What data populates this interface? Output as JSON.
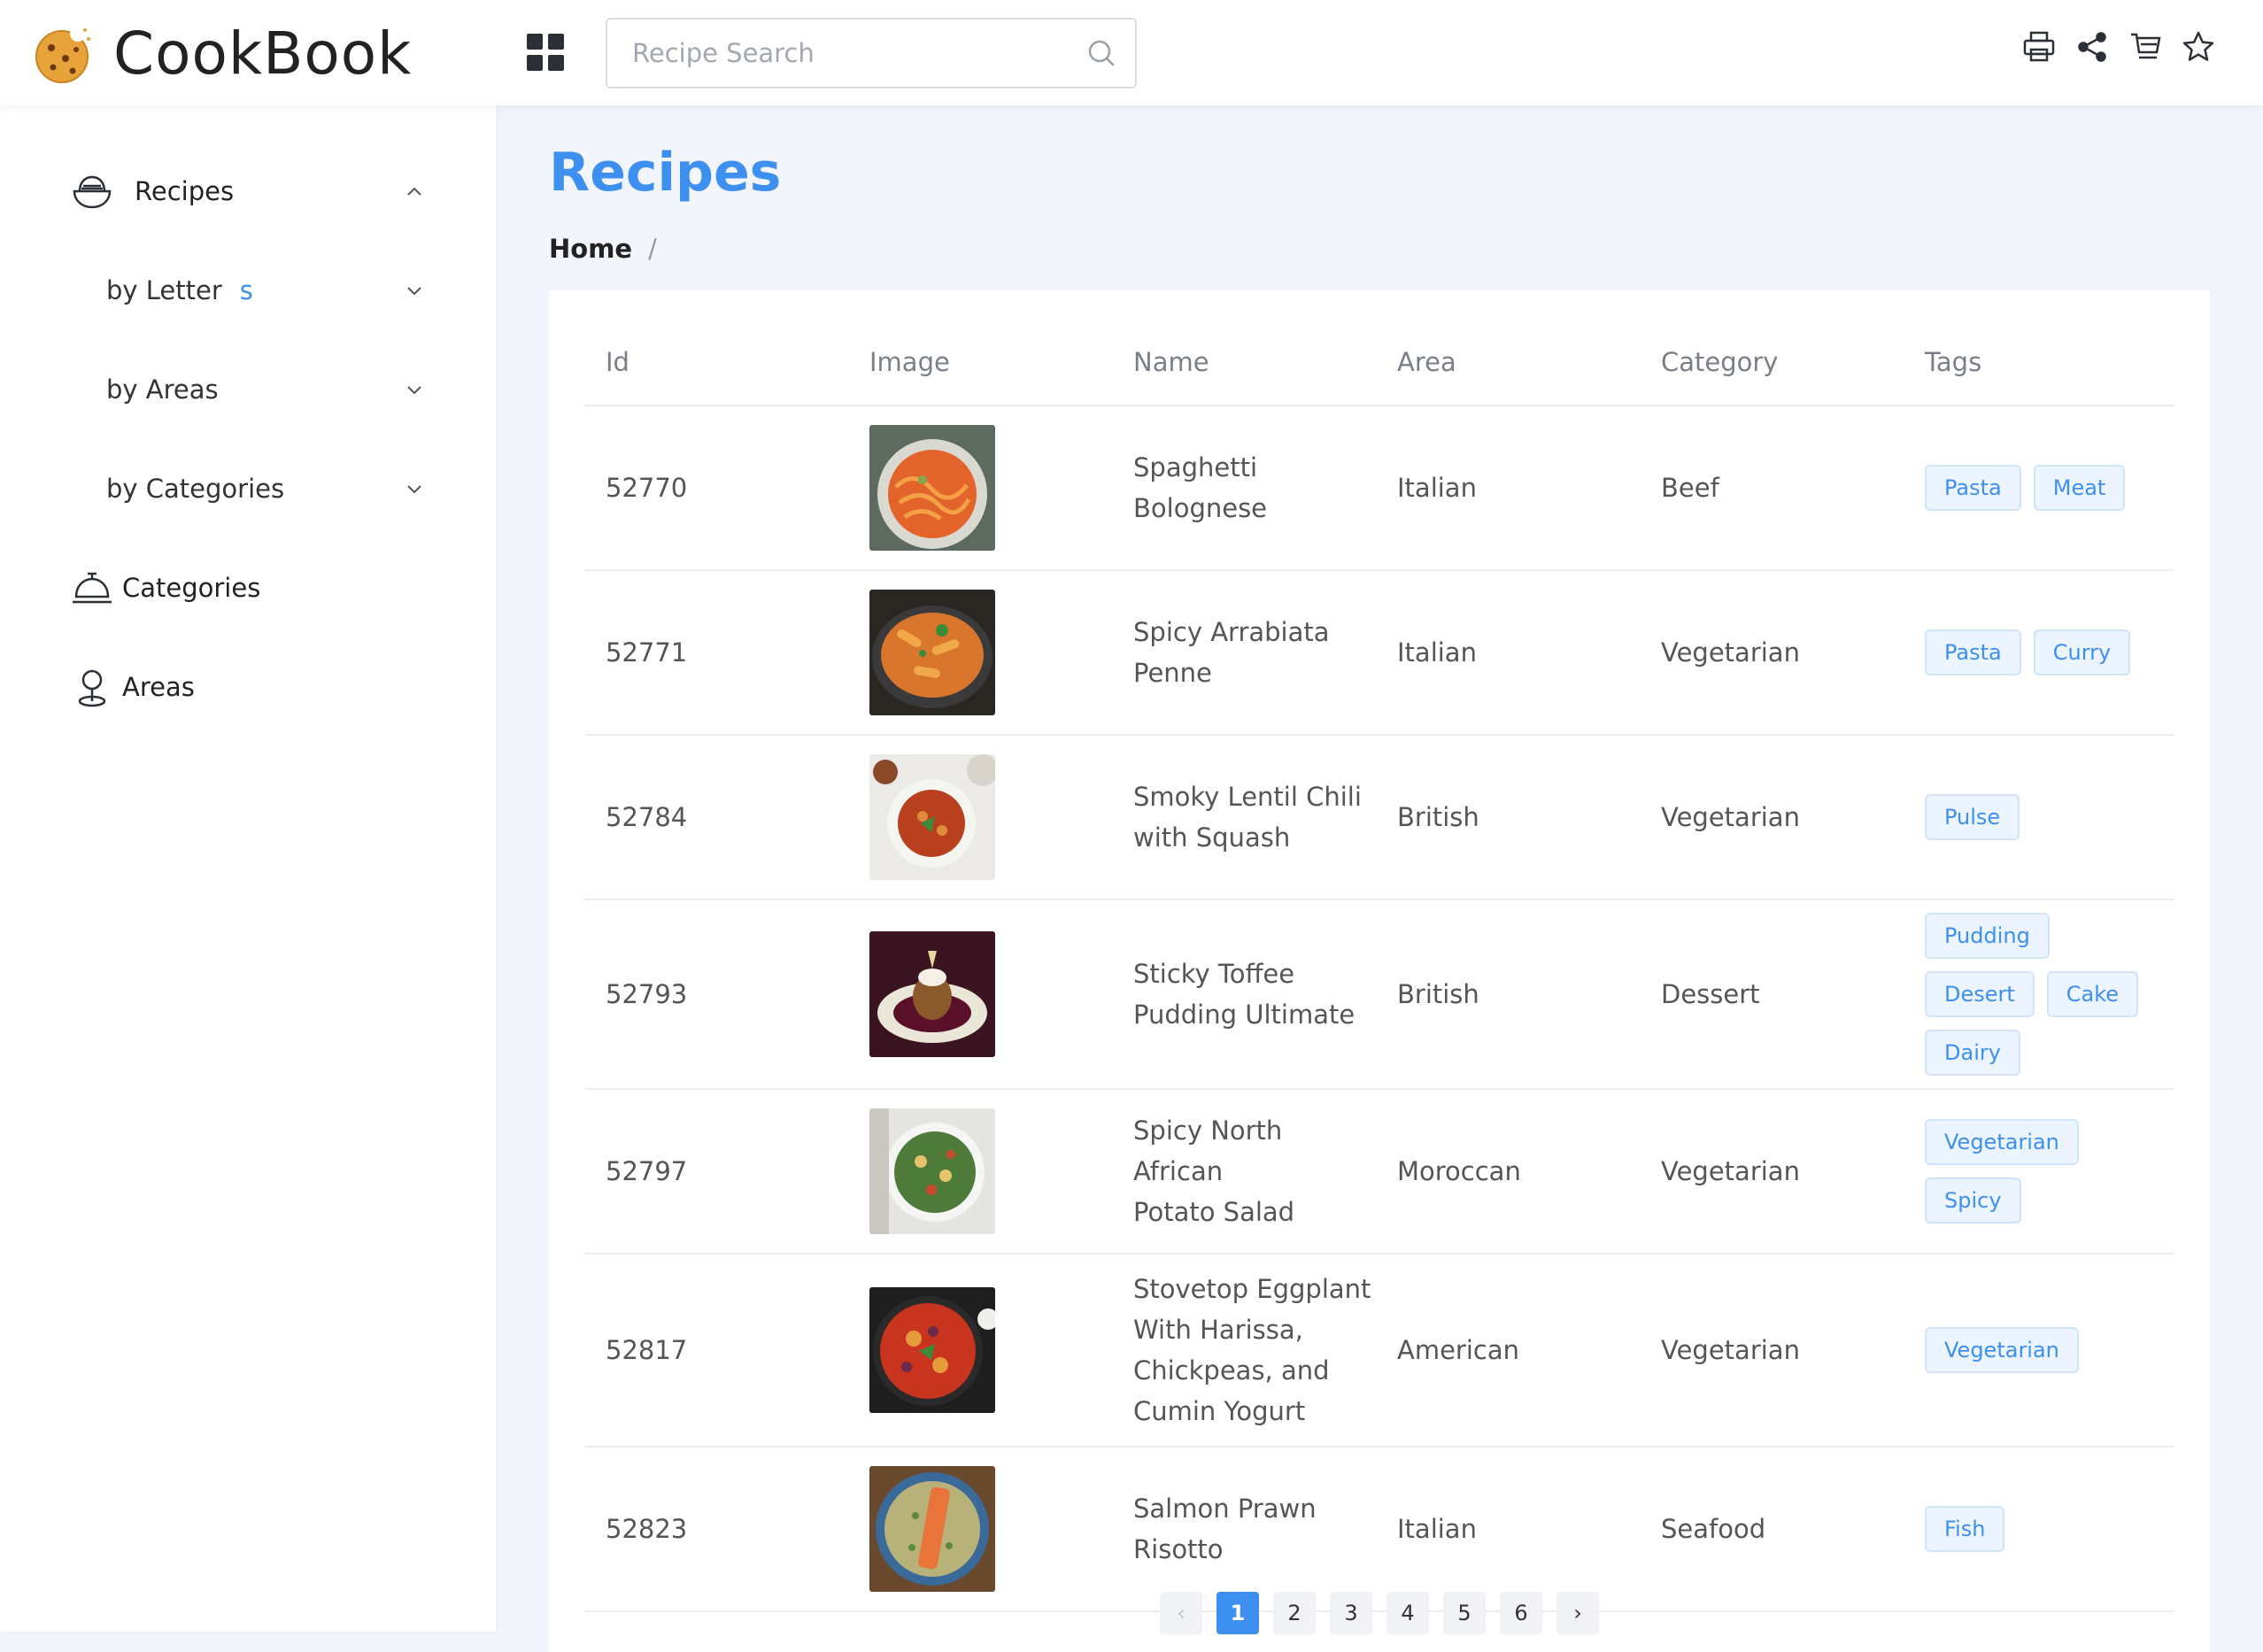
{
  "app": {
    "title": "CookBook"
  },
  "search": {
    "placeholder": "Recipe Search",
    "value": ""
  },
  "header_actions": [
    {
      "icon": "printer-icon"
    },
    {
      "icon": "share-icon"
    },
    {
      "icon": "cart-icon"
    },
    {
      "icon": "star-icon"
    }
  ],
  "sidebar": {
    "recipes": {
      "label": "Recipes",
      "expanded": true
    },
    "by_letter": {
      "label": "by Letter",
      "badge": "s"
    },
    "by_areas": {
      "label": "by Areas"
    },
    "by_categories": {
      "label": "by Categories"
    },
    "categories": {
      "label": "Categories"
    },
    "areas": {
      "label": "Areas"
    }
  },
  "main": {
    "title": "Recipes",
    "breadcrumb": {
      "home": "Home",
      "separator": "/"
    }
  },
  "table": {
    "columns": [
      "Id",
      "Image",
      "Name",
      "Area",
      "Category",
      "Tags"
    ],
    "rows": [
      {
        "id": "52770",
        "name_lines": [
          "Spaghetti",
          "Bolognese"
        ],
        "area": "Italian",
        "category": "Beef",
        "tags": [
          "Pasta",
          "Meat"
        ],
        "image": "spaghetti-bolognese"
      },
      {
        "id": "52771",
        "name_lines": [
          "Spicy Arrabiata",
          "Penne"
        ],
        "area": "Italian",
        "category": "Vegetarian",
        "tags": [
          "Pasta",
          "Curry"
        ],
        "image": "arrabiata-penne"
      },
      {
        "id": "52784",
        "name_lines": [
          "Smoky Lentil Chili",
          "with Squash"
        ],
        "area": "British",
        "category": "Vegetarian",
        "tags": [
          "Pulse"
        ],
        "image": "lentil-chili"
      },
      {
        "id": "52793",
        "name_lines": [
          "Sticky Toffee",
          "Pudding Ultimate"
        ],
        "area": "British",
        "category": "Dessert",
        "tags": [
          "Pudding",
          "Desert",
          "Cake",
          "Dairy"
        ],
        "image": "toffee-pudding"
      },
      {
        "id": "52797",
        "name_lines": [
          "Spicy North African",
          "Potato Salad"
        ],
        "area": "Moroccan",
        "category": "Vegetarian",
        "tags": [
          "Vegetarian",
          "Spicy"
        ],
        "image": "potato-salad"
      },
      {
        "id": "52817",
        "name_lines": [
          "Stovetop Eggplant",
          "With Harissa,",
          "Chickpeas, and",
          "Cumin Yogurt"
        ],
        "area": "American",
        "category": "Vegetarian",
        "tags": [
          "Vegetarian"
        ],
        "image": "eggplant-harissa"
      },
      {
        "id": "52823",
        "name_lines": [
          "Salmon Prawn",
          "Risotto"
        ],
        "area": "Italian",
        "category": "Seafood",
        "tags": [
          "Fish"
        ],
        "image": "salmon-risotto"
      }
    ]
  },
  "pagination": {
    "prev": "‹",
    "next": "›",
    "pages": [
      "1",
      "2",
      "3",
      "4",
      "5",
      "6"
    ],
    "current": "1"
  },
  "colors": {
    "accent": "#3d8ff0",
    "tag_bg": "#ecf5ff"
  }
}
